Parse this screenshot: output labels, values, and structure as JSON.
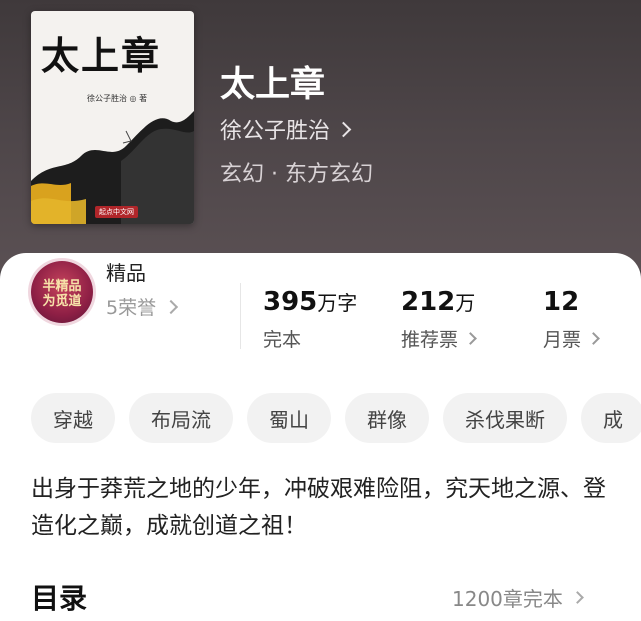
{
  "book": {
    "cover_title": "太上章",
    "cover_author": "徐公子胜治 ◎ 著",
    "cover_publisher": "起点中文网",
    "title": "太上章",
    "author": "徐公子胜治",
    "genre": "玄幻 · 东方玄幻"
  },
  "quality": {
    "badge_text": "半精品\n为觅道",
    "label": "精品",
    "honor": "5荣誉"
  },
  "stats": [
    {
      "value": "395",
      "unit": "万字",
      "label": "完本"
    },
    {
      "value": "212",
      "unit": "万",
      "label": "推荐票"
    },
    {
      "value": "12",
      "unit": "",
      "label": "月票"
    }
  ],
  "tags": [
    "穿越",
    "布局流",
    "蜀山",
    "群像",
    "杀伐果断",
    "成"
  ],
  "intro": "出身于莽荒之地的少年，冲破艰难险阻，究天地之源、登造化之巅，成就创道之祖！",
  "catalog": {
    "title": "目录",
    "info": "1200章完本"
  }
}
